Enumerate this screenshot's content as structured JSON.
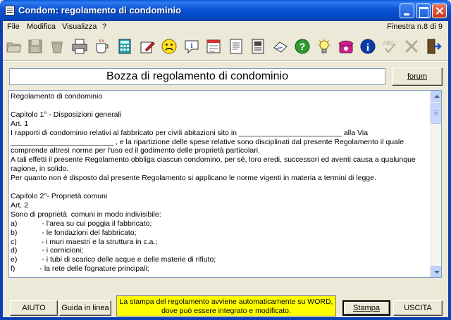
{
  "window": {
    "title": "Condom: regolamento di condominio"
  },
  "menu": {
    "items": [
      "File",
      "Modifica",
      "Visualizza",
      "?"
    ],
    "window_counter": "Finestra n.8 di 9"
  },
  "toolbar": {
    "icons": [
      "open-folder-icon",
      "save-disk-icon",
      "recycle-icon",
      "printer-icon",
      "coffee-cup-icon",
      "calculator-icon",
      "pencil-edit-icon",
      "sad-face-icon",
      "info-bubble-icon",
      "calendar-icon",
      "document-icon",
      "notes-icon",
      "signature-icon",
      "help-icon",
      "lightbulb-icon",
      "telephone-icon",
      "info-icon",
      "spell-check-icon",
      "cancel-icon",
      "exit-door-icon"
    ]
  },
  "header": {
    "doc_title": "Bozza di regolamento di condominio",
    "forum_label": "forum"
  },
  "document": {
    "text": "Regolamento di condominio\n\nCapitolo 1° - Disposizioni generali\nArt. 1\nI rapporti di condominio relativi al fabbricato per civili abitazioni sito in _________________________ alla Via\n_________________________ , e la ripartizione delle spese relative sono disciplinati dal presente Regolamento il quale\ncomprende altresì norme per l'uso ed il godimento delle proprietà particolari.\nA tali effetti il presente Regolamento obbliga ciascun condomino, per sé, loro eredi, successori ed aventi causa a qualunque\nragione, in solido.\nPer quanto non è disposto dal presente Regolamento si applicano le norme vigenti in materia a termini di legge.\n\nCapitolo 2°- Proprietà comuni\nArt. 2\nSono di proprietà  comuni in modo indivisibile:\na)            - l'area su cui poggia il fabbricato;\nb)            - le fondazioni del fabbricato;\nc)            - i muri maestri e la struttura in c.a.;\nd)            - i cornicioni;\ne)            - i tubi di scarico delle acque e delle materie di rifiuto;\nf)            - la rete delle fognature principali;"
  },
  "footer": {
    "aiuto_label": "AIUTO",
    "guida_label": "Guida in linea",
    "notice_line1": "La stampa del regolamento avviene automaticamente su WORD,",
    "notice_line2": "dove può essere integrato e modificato.",
    "stampa_label": "Stampa",
    "uscita_label": "USCITA"
  },
  "colors": {
    "titlebar": "#0853D6",
    "notice_bg": "#FFFF00",
    "face": "#ECE9D8"
  }
}
